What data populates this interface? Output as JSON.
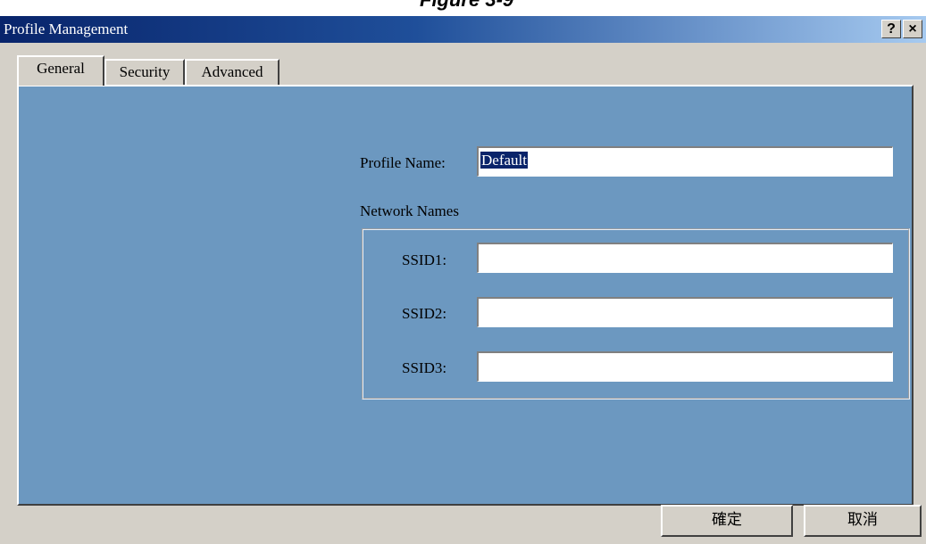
{
  "figure_caption": "Figure 3-9",
  "window": {
    "title": "Profile Management",
    "help_label": "?",
    "close_label": "×"
  },
  "tabs": [
    {
      "label": "General",
      "active": true
    },
    {
      "label": "Security",
      "active": false
    },
    {
      "label": "Advanced",
      "active": false
    }
  ],
  "general": {
    "profile_name_label": "Profile Name:",
    "profile_name_value": "Default",
    "network_names_label": "Network Names",
    "ssids": [
      {
        "label": "SSID1:",
        "value": ""
      },
      {
        "label": "SSID2:",
        "value": ""
      },
      {
        "label": "SSID3:",
        "value": ""
      }
    ]
  },
  "buttons": {
    "ok_label": "確定",
    "cancel_label": "取消"
  },
  "colors": {
    "titlebar_start": "#08246b",
    "titlebar_end": "#a6caf0",
    "panel_bg": "#6c98c0",
    "dialog_bg": "#d4d0c8"
  }
}
